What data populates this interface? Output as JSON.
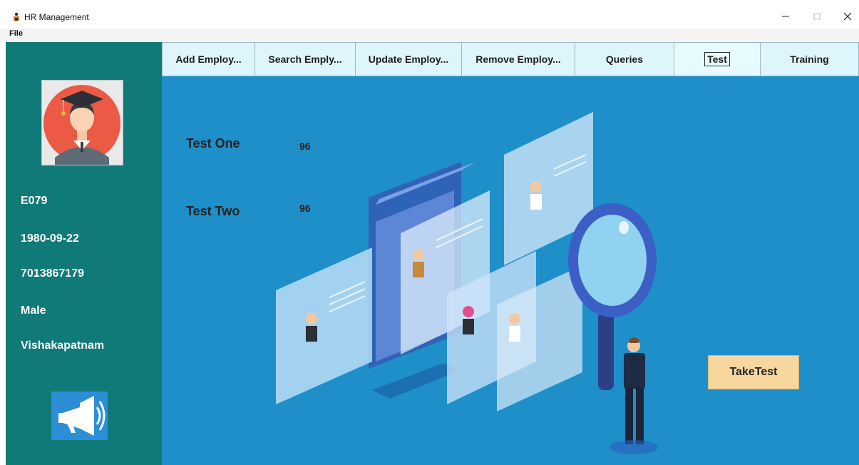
{
  "window": {
    "title": "HR Management"
  },
  "menu": {
    "file_label": "File"
  },
  "toolbar": {
    "tabs": [
      {
        "label": "Add Employ..."
      },
      {
        "label": "Search Emply..."
      },
      {
        "label": "Update Employ..."
      },
      {
        "label": "Remove Employ..."
      },
      {
        "label": "Queries"
      },
      {
        "label": "Test"
      },
      {
        "label": "Training"
      }
    ]
  },
  "sidebar": {
    "employee_id": "E079",
    "dob": "1980-09-22",
    "phone": "7013867179",
    "gender": "Male",
    "city": "Vishakapatnam"
  },
  "tests": [
    {
      "label": "Test One",
      "score": "96"
    },
    {
      "label": "Test Two",
      "score": "96"
    }
  ],
  "actions": {
    "take_test_label": "TakeTest"
  },
  "colors": {
    "sidebar": "#0f7a78",
    "main": "#1e8fc9",
    "tab": "#def6fb",
    "button": "#f7d79e"
  }
}
